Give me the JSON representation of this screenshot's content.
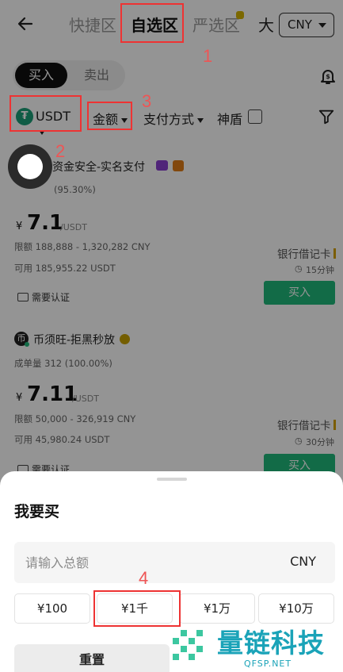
{
  "nav": {
    "tabs": [
      "快捷区",
      "自选区",
      "严选区"
    ],
    "active_tab": "自选区",
    "extra": "大",
    "currency": "CNY"
  },
  "trade_switch": {
    "buy": "买入",
    "sell": "卖出"
  },
  "filters": {
    "coin": "USDT",
    "amount": "金额",
    "payment": "支付方式",
    "shield": "神盾"
  },
  "merchants": [
    {
      "name": "资金安全-实名支付",
      "stats": "(95.30%)",
      "price": "7.1",
      "currency_symbol": "¥",
      "unit": "/USDT",
      "limit": "限额 188,888 - 1,320,282 CNY",
      "available": "可用 185,955.22 USDT",
      "payment_method": "银行借记卡",
      "time": "15分钟",
      "buy_label": "买入",
      "verify": "需要认证"
    },
    {
      "name": "币须旺-拒黑秒放",
      "stats": "成单量 312 (100.00%)",
      "price": "7.11",
      "currency_symbol": "¥",
      "unit": "/USDT",
      "limit": "限额 50,000 - 326,919 CNY",
      "available": "可用 45,980.24 USDT",
      "payment_method": "银行借记卡",
      "time": "30分钟",
      "buy_label": "买入",
      "verify": "需要认证"
    }
  ],
  "sheet": {
    "title": "我要买",
    "input_placeholder": "请输入总额",
    "input_currency": "CNY",
    "chips": [
      "¥100",
      "¥1千",
      "¥1万",
      "¥10万"
    ],
    "reset": "重置"
  },
  "annotations": [
    "1",
    "2",
    "3",
    "4"
  ],
  "watermark": {
    "text": "量链科技",
    "sub": "QFSP.NET"
  },
  "colors": {
    "buy_green": "#1fb87a",
    "annotation_red": "#e33333",
    "watermark_teal": "#1aa3b8"
  }
}
